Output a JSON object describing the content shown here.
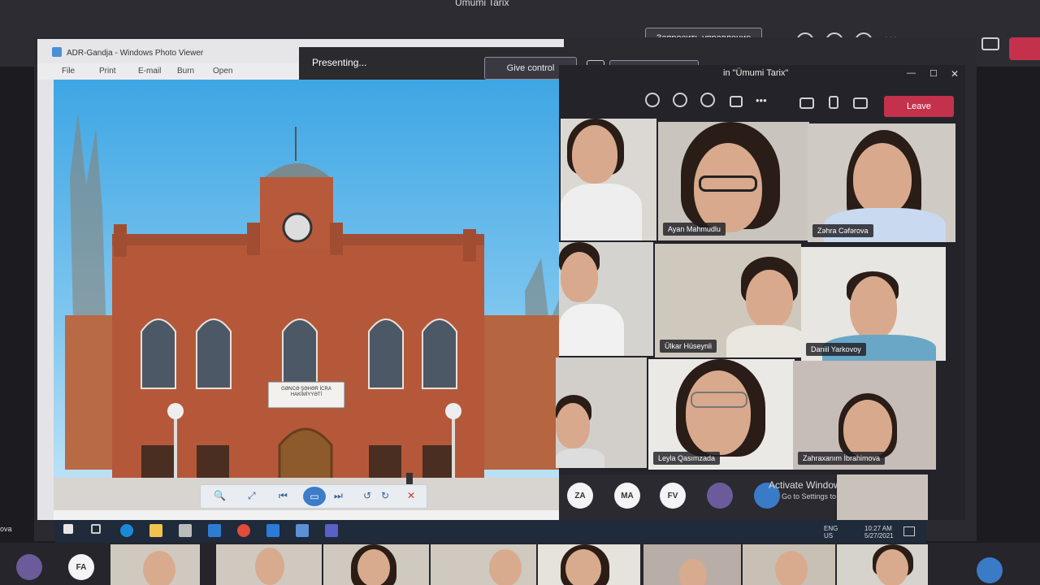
{
  "outer": {
    "title": "Ümumi Tarix",
    "request_control": "Запросить управление",
    "left_label": "ova",
    "bottom_avatar": "FA"
  },
  "viewer": {
    "title": "ADR-Gandja - Windows Photo Viewer",
    "menu": [
      "File",
      "Print",
      "E-mail",
      "Burn",
      "Open"
    ],
    "banner": "GƏNCƏ ŞƏHƏR İCRA HAKİMİYYƏTİ"
  },
  "presenting": {
    "label": "Presenting...",
    "give_control": "Give control",
    "stop": "Stop presenting"
  },
  "meeting": {
    "title": "in \"Ümumi Tarix\"",
    "leave": "Leave",
    "participants": [
      {
        "name": ""
      },
      {
        "name": "Ayan Mahmudlu"
      },
      {
        "name": "Zəhra Cəfərova"
      },
      {
        "name": ""
      },
      {
        "name": "Ülkar Hüseynli"
      },
      {
        "name": "Daniil Yarkovoy"
      },
      {
        "name": ""
      },
      {
        "name": "Leyla Qasımzada"
      },
      {
        "name": "Zahraxanım İbrahimova"
      }
    ],
    "avatars": [
      "ZA",
      "MA",
      "FV"
    ],
    "activate_title": "Activate Windows",
    "activate_sub": "Go to Settings to activate"
  },
  "taskbar": {
    "lang": "ENG",
    "region": "US",
    "time": "10:27 AM",
    "date": "5/27/2021"
  }
}
